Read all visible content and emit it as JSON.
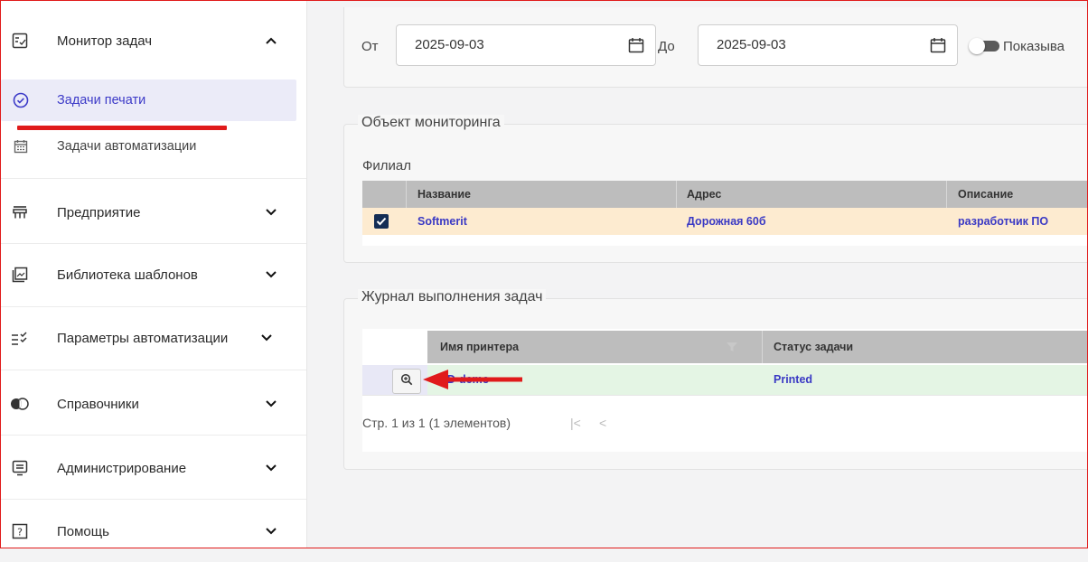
{
  "sidebar": {
    "sections": [
      {
        "label": "Монитор задач",
        "icon": "monitor-tasks-icon",
        "chevron": "up"
      },
      {
        "label": "Предприятие",
        "icon": "enterprise-icon",
        "chevron": "down"
      },
      {
        "label": "Библиотека шаблонов",
        "icon": "template-library-icon",
        "chevron": "down"
      },
      {
        "label": "Параметры автоматизации",
        "icon": "automation-params-icon",
        "chevron": "down"
      },
      {
        "label": "Справочники",
        "icon": "reference-books-icon",
        "chevron": "down"
      },
      {
        "label": "Администрирование",
        "icon": "administration-icon",
        "chevron": "down"
      },
      {
        "label": "Помощь",
        "icon": "help-icon",
        "chevron": "down"
      }
    ],
    "subitems": [
      {
        "label": "Задачи печати",
        "icon": "check-circle-icon",
        "active": true
      },
      {
        "label": "Задачи автоматизации",
        "icon": "calendar-icon",
        "active": false
      }
    ]
  },
  "filter": {
    "from_label": "От",
    "from_value": "2025-09-03",
    "to_label": "До",
    "to_value": "2025-09-03",
    "toggle_label": "Показыва"
  },
  "monitor": {
    "legend": "Объект мониторинга",
    "branch_label": "Филиал",
    "columns": [
      "Название",
      "Адрес",
      "Описание"
    ],
    "rows": [
      {
        "checked": true,
        "cells": [
          "Softmerit",
          "Дорожная 60б",
          "разработчик ПО"
        ]
      }
    ]
  },
  "journal": {
    "legend": "Журнал выполнения задач",
    "columns": [
      "Имя принтера",
      "Статус задачи"
    ],
    "rows": [
      {
        "cells": [
          "ЗD-demo",
          "Printed"
        ]
      }
    ],
    "pager_info": "Стр. 1 из 1 (1 элементов)",
    "pager_first": "|<",
    "pager_prev": "<"
  },
  "colors": {
    "accent": "#3c3ac8",
    "annotation_red": "#e01b1b",
    "selected_row": "#fdebd0",
    "journal_row": "#e4f5e4"
  }
}
